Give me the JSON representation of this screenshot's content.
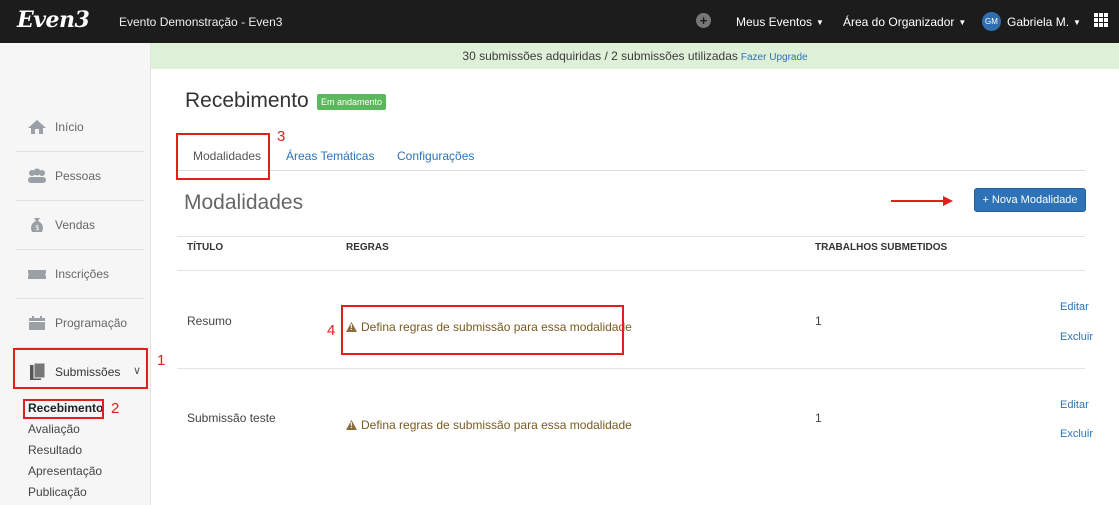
{
  "topbar": {
    "logo": "Even3",
    "event_title": "Evento Demonstração - Even3",
    "plus_icon": "+",
    "my_events": "Meus Eventos",
    "organizer_area": "Área do Organizador",
    "avatar_initials": "GM",
    "user_name": "Gabriela M.",
    "caret": "▼"
  },
  "banner": {
    "text": "30 submissões adquiridas / 2 submissões utilizadas",
    "upgrade_link": "Fazer Upgrade"
  },
  "sidebar": {
    "items": [
      {
        "label": "Início",
        "icon": "home-icon"
      },
      {
        "label": "Pessoas",
        "icon": "people-icon"
      },
      {
        "label": "Vendas",
        "icon": "money-bag-icon"
      },
      {
        "label": "Inscrições",
        "icon": "ticket-icon"
      },
      {
        "label": "Programação",
        "icon": "calendar-icon"
      },
      {
        "label": "Submissões",
        "icon": "documents-icon",
        "chevron": "∨"
      }
    ],
    "sub_items": [
      "Recebimento",
      "Avaliação",
      "Resultado",
      "Apresentação",
      "Publicação"
    ]
  },
  "page": {
    "title": "Recebimento",
    "status": "Em andamento",
    "tabs": [
      "Modalidades",
      "Áreas Temáticas",
      "Configurações"
    ],
    "section_title": "Modalidades",
    "new_button": "+ Nova Modalidade"
  },
  "table": {
    "headers": [
      "TÍTULO",
      "REGRAS",
      "TRABALHOS SUBMETIDOS"
    ],
    "rows": [
      {
        "title": "Resumo",
        "rules": "Defina regras de submissão para essa modalidade",
        "submitted": "1",
        "edit": "Editar",
        "delete": "Excluir"
      },
      {
        "title": "Submissão teste",
        "rules": "Defina regras de submissão para essa modalidade",
        "submitted": "1",
        "edit": "Editar",
        "delete": "Excluir"
      }
    ]
  },
  "annotations": [
    "1",
    "2",
    "3",
    "4"
  ],
  "colors": {
    "topbar": "#1c1c1c",
    "banner": "#dff0d8",
    "primary": "#2e73b8",
    "success": "#5cb85c",
    "warning_text": "#7a5a1f",
    "annotation": "#e0201a"
  }
}
